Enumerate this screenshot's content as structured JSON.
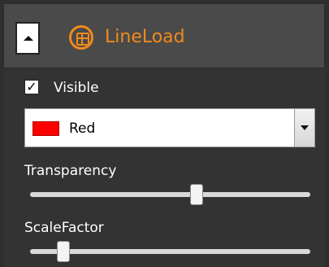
{
  "header": {
    "title": "LineLoad",
    "accent_color": "#f08a1c",
    "layer_icon": "grid-circle-icon",
    "collapse_icon": "triangle-up-icon"
  },
  "visible": {
    "label": "Visible",
    "checked": true,
    "check_glyph": "✓"
  },
  "color_select": {
    "value": "Red",
    "swatch_color": "#ff0000",
    "arrow_icon": "chevron-down-icon"
  },
  "sliders": [
    {
      "label": "Transparency",
      "value": 0.6
    },
    {
      "label": "ScaleFactor",
      "value": 0.1
    }
  ]
}
